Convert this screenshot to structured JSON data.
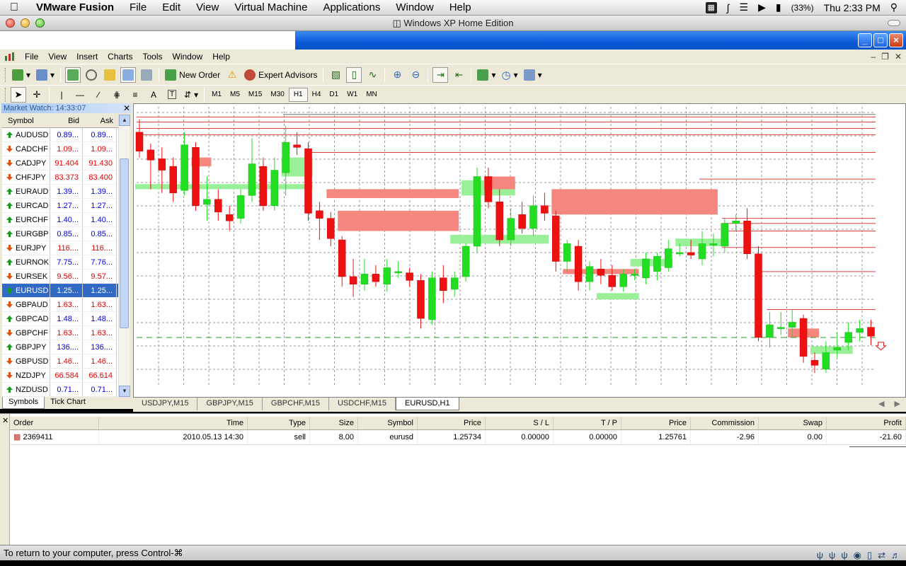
{
  "mac_menu": {
    "app_name": "VMware Fusion",
    "items": [
      "File",
      "Edit",
      "View",
      "Virtual Machine",
      "Applications",
      "Window",
      "Help"
    ],
    "battery": "(33%)",
    "clock": "Thu 2:33 PM"
  },
  "vm_window": {
    "title": "Windows XP Home Edition",
    "status_text": "To return to your computer, press Control-⌘"
  },
  "mt_menu": [
    "File",
    "View",
    "Insert",
    "Charts",
    "Tools",
    "Window",
    "Help"
  ],
  "toolbar": {
    "new_order": "New Order",
    "expert_advisors": "Expert Advisors",
    "timeframes": [
      "M1",
      "M5",
      "M15",
      "M30",
      "H1",
      "H4",
      "D1",
      "W1",
      "MN"
    ],
    "selected_timeframe": "H1",
    "text_tool": "A"
  },
  "market_watch": {
    "title": "Market Watch: 14:33:07",
    "col_symbol": "Symbol",
    "col_bid": "Bid",
    "col_ask": "Ask",
    "rows": [
      {
        "symbol": "AUDUSD",
        "bid": "0.89...",
        "ask": "0.89...",
        "dir": "up"
      },
      {
        "symbol": "CADCHF",
        "bid": "1.09...",
        "ask": "1.09...",
        "dir": "down"
      },
      {
        "symbol": "CADJPY",
        "bid": "91.404",
        "ask": "91.430",
        "dir": "down"
      },
      {
        "symbol": "CHFJPY",
        "bid": "83.373",
        "ask": "83.400",
        "dir": "down"
      },
      {
        "symbol": "EURAUD",
        "bid": "1.39...",
        "ask": "1.39...",
        "dir": "up"
      },
      {
        "symbol": "EURCAD",
        "bid": "1.27...",
        "ask": "1.27...",
        "dir": "up"
      },
      {
        "symbol": "EURCHF",
        "bid": "1.40...",
        "ask": "1.40...",
        "dir": "up"
      },
      {
        "symbol": "EURGBP",
        "bid": "0.85...",
        "ask": "0.85...",
        "dir": "up"
      },
      {
        "symbol": "EURJPY",
        "bid": "116....",
        "ask": "116....",
        "dir": "down"
      },
      {
        "symbol": "EURNOK",
        "bid": "7.75...",
        "ask": "7.76...",
        "dir": "up"
      },
      {
        "symbol": "EURSEK",
        "bid": "9.56...",
        "ask": "9.57...",
        "dir": "down"
      },
      {
        "symbol": "EURUSD",
        "bid": "1.25...",
        "ask": "1.25...",
        "dir": "up",
        "selected": true
      },
      {
        "symbol": "GBPAUD",
        "bid": "1.63...",
        "ask": "1.63...",
        "dir": "down"
      },
      {
        "symbol": "GBPCAD",
        "bid": "1.48...",
        "ask": "1.48...",
        "dir": "up"
      },
      {
        "symbol": "GBPCHF",
        "bid": "1.63...",
        "ask": "1.63...",
        "dir": "down"
      },
      {
        "symbol": "GBPJPY",
        "bid": "136....",
        "ask": "136....",
        "dir": "up"
      },
      {
        "symbol": "GBPUSD",
        "bid": "1.46...",
        "ask": "1.46...",
        "dir": "down"
      },
      {
        "symbol": "NZDJPY",
        "bid": "66.584",
        "ask": "66.614",
        "dir": "down"
      },
      {
        "symbol": "NZDUSD",
        "bid": "0.71...",
        "ask": "0.71...",
        "dir": "up"
      }
    ],
    "tabs": [
      "Symbols",
      "Tick Chart"
    ]
  },
  "chart_tabs": [
    "USDJPY,M15",
    "GBPJPY,M15",
    "GBPCHF,M15",
    "USDCHF,M15",
    "EURUSD,H1"
  ],
  "active_chart_tab": "EURUSD,H1",
  "chart_data": {
    "type": "candlestick",
    "series_note": "EURUSD H1 candles",
    "up_color": "#22dd22",
    "down_color": "#ee1111",
    "candles": [
      {
        "o": 1.279,
        "h": 1.28,
        "l": 1.277,
        "c": 1.2775
      },
      {
        "o": 1.2776,
        "h": 1.2781,
        "l": 1.2745,
        "c": 1.2768
      },
      {
        "o": 1.2769,
        "h": 1.2778,
        "l": 1.2742,
        "c": 1.276
      },
      {
        "o": 1.2763,
        "h": 1.277,
        "l": 1.2735,
        "c": 1.2742
      },
      {
        "o": 1.2744,
        "h": 1.279,
        "l": 1.274,
        "c": 1.278
      },
      {
        "o": 1.2778,
        "h": 1.2782,
        "l": 1.2728,
        "c": 1.2732
      },
      {
        "o": 1.2733,
        "h": 1.2755,
        "l": 1.272,
        "c": 1.2737
      },
      {
        "o": 1.2737,
        "h": 1.2745,
        "l": 1.272,
        "c": 1.2727
      },
      {
        "o": 1.2725,
        "h": 1.2732,
        "l": 1.2712,
        "c": 1.272
      },
      {
        "o": 1.2722,
        "h": 1.2745,
        "l": 1.2718,
        "c": 1.274
      },
      {
        "o": 1.274,
        "h": 1.2785,
        "l": 1.2735,
        "c": 1.2765
      },
      {
        "o": 1.2763,
        "h": 1.277,
        "l": 1.2728,
        "c": 1.2732
      },
      {
        "o": 1.2732,
        "h": 1.277,
        "l": 1.2728,
        "c": 1.276
      },
      {
        "o": 1.2758,
        "h": 1.2795,
        "l": 1.274,
        "c": 1.2782
      },
      {
        "o": 1.278,
        "h": 1.279,
        "l": 1.2772,
        "c": 1.2778
      },
      {
        "o": 1.2777,
        "h": 1.2782,
        "l": 1.272,
        "c": 1.2726
      },
      {
        "o": 1.2728,
        "h": 1.2735,
        "l": 1.2705,
        "c": 1.2722
      },
      {
        "o": 1.2722,
        "h": 1.2727,
        "l": 1.27,
        "c": 1.2706
      },
      {
        "o": 1.2705,
        "h": 1.2708,
        "l": 1.2668,
        "c": 1.2676
      },
      {
        "o": 1.2676,
        "h": 1.269,
        "l": 1.266,
        "c": 1.267
      },
      {
        "o": 1.267,
        "h": 1.269,
        "l": 1.2665,
        "c": 1.2678
      },
      {
        "o": 1.2678,
        "h": 1.2685,
        "l": 1.2668,
        "c": 1.2672
      },
      {
        "o": 1.267,
        "h": 1.269,
        "l": 1.2664,
        "c": 1.2683
      },
      {
        "o": 1.268,
        "h": 1.2688,
        "l": 1.2675,
        "c": 1.268
      },
      {
        "o": 1.2679,
        "h": 1.2683,
        "l": 1.2668,
        "c": 1.2673
      },
      {
        "o": 1.2673,
        "h": 1.2678,
        "l": 1.2635,
        "c": 1.2643
      },
      {
        "o": 1.2642,
        "h": 1.268,
        "l": 1.2638,
        "c": 1.2675
      },
      {
        "o": 1.2675,
        "h": 1.2685,
        "l": 1.2655,
        "c": 1.2665
      },
      {
        "o": 1.2666,
        "h": 1.268,
        "l": 1.266,
        "c": 1.2675
      },
      {
        "o": 1.2676,
        "h": 1.2702,
        "l": 1.2672,
        "c": 1.27
      },
      {
        "o": 1.27,
        "h": 1.2762,
        "l": 1.2695,
        "c": 1.2755
      },
      {
        "o": 1.2755,
        "h": 1.2762,
        "l": 1.273,
        "c": 1.2735
      },
      {
        "o": 1.2735,
        "h": 1.2745,
        "l": 1.27,
        "c": 1.2705
      },
      {
        "o": 1.2705,
        "h": 1.273,
        "l": 1.27,
        "c": 1.2722
      },
      {
        "o": 1.2725,
        "h": 1.2735,
        "l": 1.271,
        "c": 1.2714
      },
      {
        "o": 1.2714,
        "h": 1.274,
        "l": 1.2708,
        "c": 1.2732
      },
      {
        "o": 1.2732,
        "h": 1.2742,
        "l": 1.272,
        "c": 1.2726
      },
      {
        "o": 1.2724,
        "h": 1.2728,
        "l": 1.268,
        "c": 1.2688
      },
      {
        "o": 1.2688,
        "h": 1.2705,
        "l": 1.268,
        "c": 1.2702
      },
      {
        "o": 1.27,
        "h": 1.2705,
        "l": 1.2665,
        "c": 1.2672
      },
      {
        "o": 1.2672,
        "h": 1.2688,
        "l": 1.2665,
        "c": 1.2684
      },
      {
        "o": 1.2682,
        "h": 1.269,
        "l": 1.267,
        "c": 1.2677
      },
      {
        "o": 1.2677,
        "h": 1.2685,
        "l": 1.2665,
        "c": 1.2668
      },
      {
        "o": 1.2668,
        "h": 1.2682,
        "l": 1.2664,
        "c": 1.2678
      },
      {
        "o": 1.2678,
        "h": 1.2682,
        "l": 1.2673,
        "c": 1.2678
      },
      {
        "o": 1.2675,
        "h": 1.2695,
        "l": 1.267,
        "c": 1.269
      },
      {
        "o": 1.268,
        "h": 1.2695,
        "l": 1.2673,
        "c": 1.2692
      },
      {
        "o": 1.2683,
        "h": 1.2705,
        "l": 1.268,
        "c": 1.2698
      },
      {
        "o": 1.2695,
        "h": 1.2702,
        "l": 1.2692,
        "c": 1.2695
      },
      {
        "o": 1.2695,
        "h": 1.2705,
        "l": 1.269,
        "c": 1.2693
      },
      {
        "o": 1.269,
        "h": 1.2712,
        "l": 1.2685,
        "c": 1.2702
      },
      {
        "o": 1.2702,
        "h": 1.271,
        "l": 1.2692,
        "c": 1.2702
      },
      {
        "o": 1.27,
        "h": 1.2722,
        "l": 1.2695,
        "c": 1.2718
      },
      {
        "o": 1.2718,
        "h": 1.2725,
        "l": 1.2712,
        "c": 1.272
      },
      {
        "o": 1.272,
        "h": 1.273,
        "l": 1.269,
        "c": 1.2694
      },
      {
        "o": 1.2694,
        "h": 1.27,
        "l": 1.2625,
        "c": 1.2628
      },
      {
        "o": 1.2628,
        "h": 1.2648,
        "l": 1.262,
        "c": 1.2638
      },
      {
        "o": 1.2635,
        "h": 1.2648,
        "l": 1.263,
        "c": 1.2636
      },
      {
        "o": 1.2636,
        "h": 1.265,
        "l": 1.2628,
        "c": 1.264
      },
      {
        "o": 1.2643,
        "h": 1.2646,
        "l": 1.2608,
        "c": 1.2613
      },
      {
        "o": 1.261,
        "h": 1.2616,
        "l": 1.26,
        "c": 1.2606
      },
      {
        "o": 1.2603,
        "h": 1.2625,
        "l": 1.26,
        "c": 1.2616
      },
      {
        "o": 1.2618,
        "h": 1.2632,
        "l": 1.2612,
        "c": 1.262
      },
      {
        "o": 1.2624,
        "h": 1.264,
        "l": 1.2618,
        "c": 1.2632
      },
      {
        "o": 1.2632,
        "h": 1.2642,
        "l": 1.2625,
        "c": 1.2635
      },
      {
        "o": 1.2636,
        "h": 1.2642,
        "l": 1.2622,
        "c": 1.2629
      }
    ],
    "ylim": [
      1.259,
      1.281
    ],
    "grid": true,
    "zones": [
      {
        "x0": 0,
        "x1": 15,
        "y0": 1.2745,
        "y1": 1.2749,
        "color": "#99f099"
      },
      {
        "x0": 5,
        "x1": 6,
        "y0": 1.2763,
        "y1": 1.277,
        "color": "#f5877f"
      },
      {
        "x0": 13,
        "x1": 15,
        "y0": 1.2755,
        "y1": 1.277,
        "color": "#99f099"
      },
      {
        "x0": 17,
        "x1": 28,
        "y0": 1.2738,
        "y1": 1.2745,
        "color": "#f5877f"
      },
      {
        "x0": 18,
        "x1": 28,
        "y0": 1.2712,
        "y1": 1.2728,
        "color": "#f5877f"
      },
      {
        "x0": 28,
        "x1": 36,
        "y0": 1.2702,
        "y1": 1.2709,
        "color": "#99f099"
      },
      {
        "x0": 29,
        "x1": 33,
        "y0": 1.274,
        "y1": 1.2752,
        "color": "#99f099"
      },
      {
        "x0": 31,
        "x1": 33,
        "y0": 1.2745,
        "y1": 1.2755,
        "color": "#f5877f"
      },
      {
        "x0": 37,
        "x1": 51,
        "y0": 1.2725,
        "y1": 1.2745,
        "color": "#f5877f"
      },
      {
        "x0": 38,
        "x1": 44,
        "y0": 1.2678,
        "y1": 1.2682,
        "color": "#f5877f"
      },
      {
        "x0": 41,
        "x1": 44,
        "y0": 1.2658,
        "y1": 1.2663,
        "color": "#99f099"
      },
      {
        "x0": 44,
        "x1": 47,
        "y0": 1.2684,
        "y1": 1.269,
        "color": "#99f099"
      },
      {
        "x0": 48,
        "x1": 52,
        "y0": 1.27,
        "y1": 1.2706,
        "color": "#99f099"
      },
      {
        "x0": 58,
        "x1": 60,
        "y0": 1.2628,
        "y1": 1.2635,
        "color": "#f5877f"
      },
      {
        "x0": 60,
        "x1": 63,
        "y0": 1.2615,
        "y1": 1.2621,
        "color": "#99f099"
      }
    ],
    "hlines": [
      {
        "y": 1.2802,
        "color": "#e04040",
        "x0": 0
      },
      {
        "y": 1.2798,
        "color": "#e04040",
        "x0": 0
      },
      {
        "y": 1.2793,
        "color": "#e04040",
        "x0": 0
      },
      {
        "y": 1.2788,
        "color": "#e04040",
        "x0": 0
      },
      {
        "y": 1.2804,
        "color": "#777777",
        "x0": 13
      },
      {
        "y": 1.2774,
        "color": "#e04040",
        "x0": 15
      },
      {
        "y": 1.2753,
        "color": "#e04040",
        "x0": 50
      },
      {
        "y": 1.2722,
        "color": "#e04040",
        "x0": 52
      },
      {
        "y": 1.2718,
        "color": "#e04040",
        "x0": 52
      },
      {
        "y": 1.2712,
        "color": "#e04040",
        "x0": 52
      },
      {
        "y": 1.2699,
        "color": "#e04040",
        "x0": 52
      },
      {
        "y": 1.268,
        "color": "#e04040",
        "x0": 55
      },
      {
        "y": 1.265,
        "color": "#e04040",
        "x0": 56
      }
    ],
    "bid_line": 1.2628
  },
  "terminal": {
    "columns": [
      "Order",
      "Time",
      "Type",
      "Size",
      "Symbol",
      "Price",
      "S / L",
      "T / P",
      "Price",
      "Commission",
      "Swap",
      "Profit"
    ],
    "row": {
      "order": "2369411",
      "time": "2010.05.13 14:30",
      "type": "sell",
      "size": "8.00",
      "symbol": "eurusd",
      "price": "1.25734",
      "sl": "0.00000",
      "tp": "0.00000",
      "price2": "1.25761",
      "commission": "-2.96",
      "swap": "0.00",
      "profit": "-21.60"
    }
  }
}
